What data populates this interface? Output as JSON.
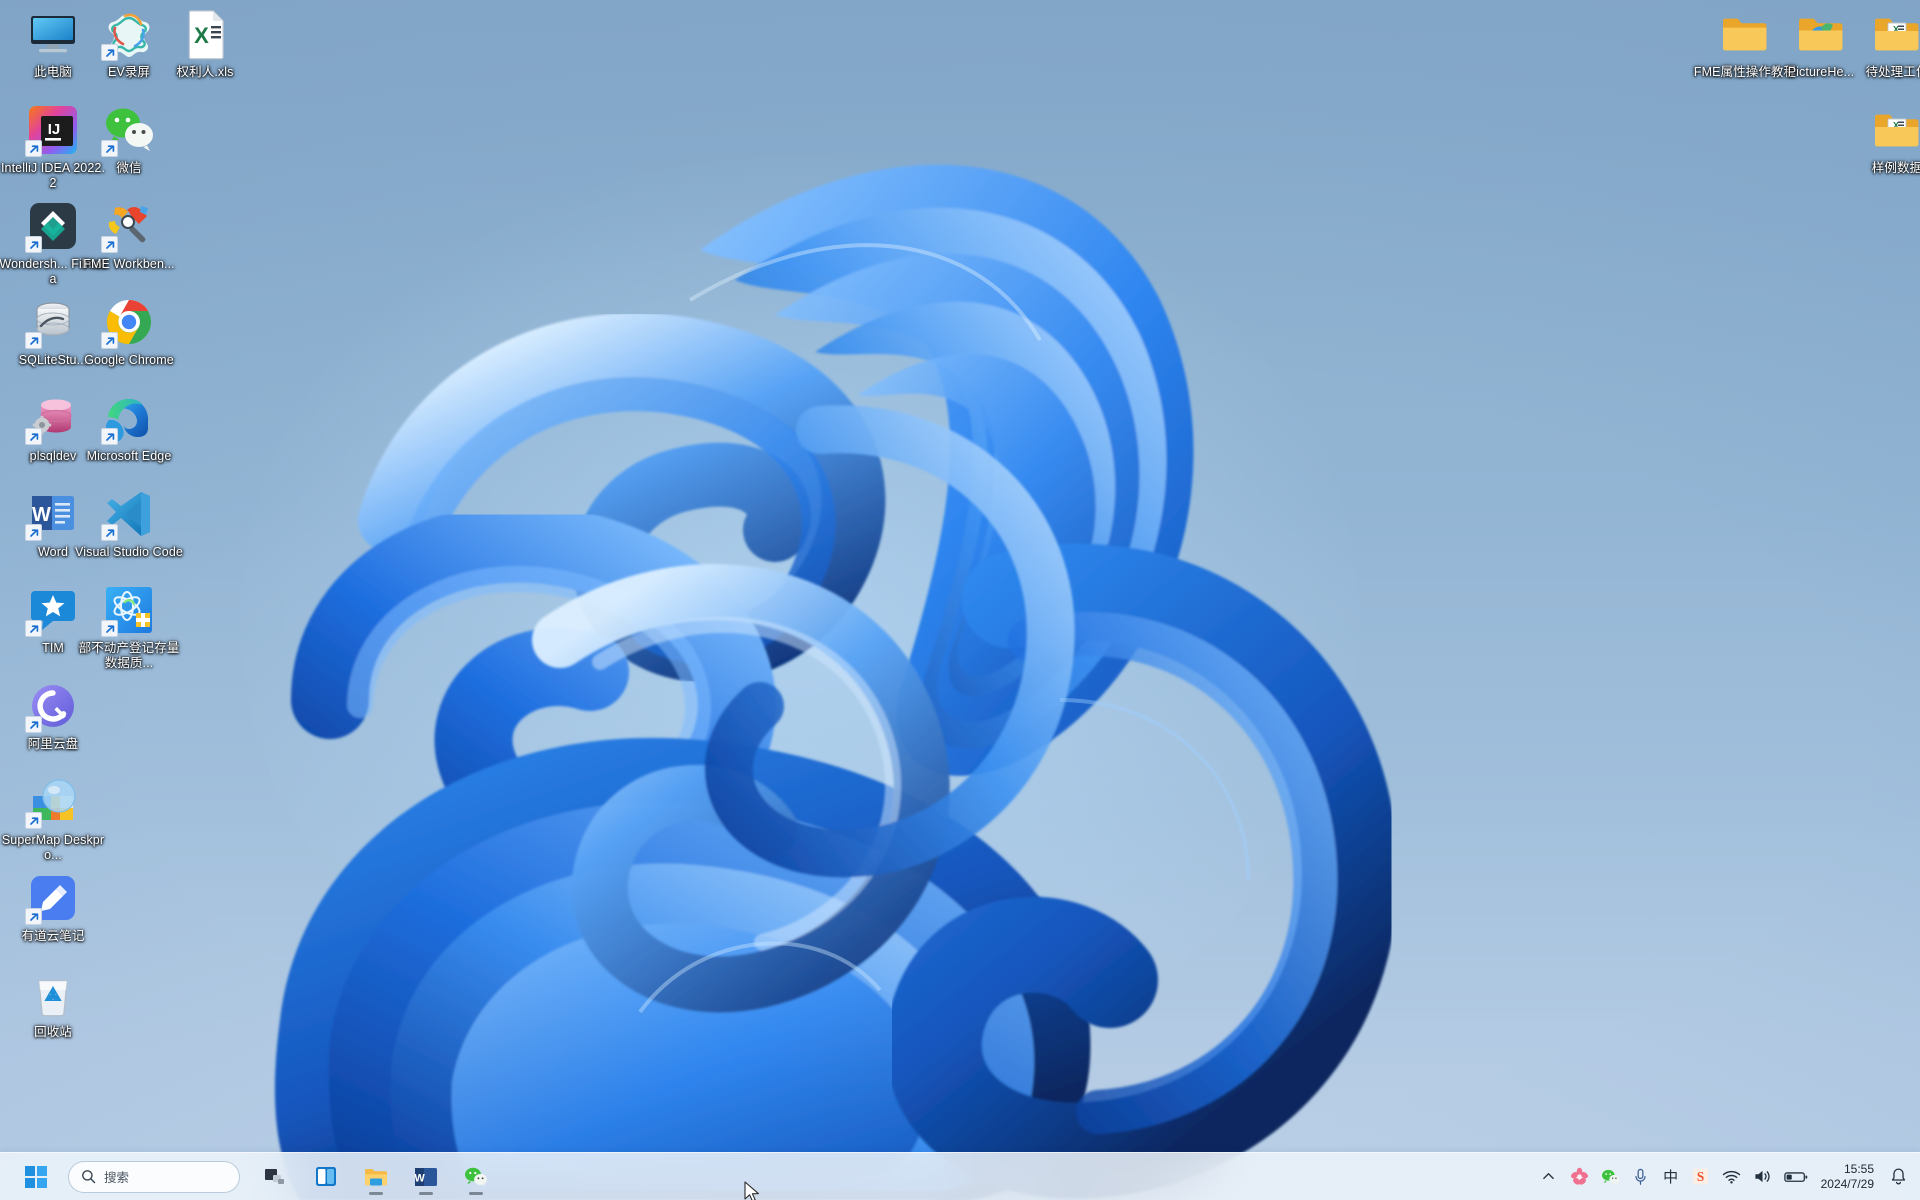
{
  "desktop": {
    "wallpaper_name": "windows-11-bloom-blue",
    "background_top_color": "#8aadcc",
    "background_bottom_color": "#bcd1e8",
    "bloom_color": "#1f6fe0",
    "icons_left": [
      {
        "label": "此电脑",
        "icon": "this-pc-icon",
        "shortcut": false,
        "col": 0,
        "row": 0
      },
      {
        "label": "EV录屏",
        "icon": "ev-recorder-icon",
        "shortcut": true,
        "col": 1,
        "row": 0
      },
      {
        "label": "权利人.xls",
        "icon": "excel-file-icon",
        "shortcut": false,
        "col": 2,
        "row": 0
      },
      {
        "label": "IntelliJ IDEA 2022.2",
        "icon": "intellij-idea-icon",
        "shortcut": true,
        "col": 0,
        "row": 1
      },
      {
        "label": "微信",
        "icon": "wechat-icon",
        "shortcut": true,
        "col": 1,
        "row": 1
      },
      {
        "label": "Wondersh... Filmora",
        "icon": "filmora-icon",
        "shortcut": true,
        "col": 0,
        "row": 2
      },
      {
        "label": "FME Workben...",
        "icon": "fme-workbench-icon",
        "shortcut": true,
        "col": 1,
        "row": 2
      },
      {
        "label": "SQLiteStu...",
        "icon": "sqlite-studio-icon",
        "shortcut": true,
        "col": 0,
        "row": 3
      },
      {
        "label": "Google Chrome",
        "icon": "google-chrome-icon",
        "shortcut": true,
        "col": 1,
        "row": 3
      },
      {
        "label": "plsqldev",
        "icon": "plsql-developer-icon",
        "shortcut": true,
        "col": 0,
        "row": 4
      },
      {
        "label": "Microsoft Edge",
        "icon": "microsoft-edge-icon",
        "shortcut": true,
        "col": 1,
        "row": 4
      },
      {
        "label": "Word",
        "icon": "microsoft-word-icon",
        "shortcut": true,
        "col": 0,
        "row": 5
      },
      {
        "label": "Visual Studio Code",
        "icon": "visual-studio-code-icon",
        "shortcut": true,
        "col": 1,
        "row": 5
      },
      {
        "label": "TIM",
        "icon": "tim-icon",
        "shortcut": true,
        "col": 0,
        "row": 6
      },
      {
        "label": "部不动产登记存量数据质...",
        "icon": "realestate-registry-app-icon",
        "shortcut": true,
        "col": 1,
        "row": 6
      },
      {
        "label": "阿里云盘",
        "icon": "aliyun-drive-icon",
        "shortcut": true,
        "col": 0,
        "row": 7
      },
      {
        "label": "SuperMap Deskpro...",
        "icon": "supermap-deskpro-icon",
        "shortcut": true,
        "col": 0,
        "row": 8
      },
      {
        "label": "有道云笔记",
        "icon": "youdao-note-icon",
        "shortcut": true,
        "col": 0,
        "row": 9
      },
      {
        "label": "回收站",
        "icon": "recycle-bin-icon",
        "shortcut": false,
        "col": 0,
        "row": 10
      }
    ],
    "icons_right": [
      {
        "label": "FME属性操作教程",
        "icon": "folder-icon",
        "col": 0,
        "row": 0
      },
      {
        "label": "PictureHe...",
        "icon": "folder-picture-icon",
        "col": 1,
        "row": 0
      },
      {
        "label": "待处理工作",
        "icon": "folder-documents-icon",
        "col": 2,
        "row": 0
      },
      {
        "label": "样例数据",
        "icon": "folder-documents-icon",
        "col": 2,
        "row": 1
      }
    ]
  },
  "taskbar": {
    "start_label": "开始",
    "start_icon": "windows-logo-icon",
    "search": {
      "placeholder": "搜索",
      "value": "",
      "icon": "search-icon"
    },
    "pinned": [
      {
        "label": "任务视图",
        "icon": "task-view-icon",
        "running": false
      },
      {
        "label": "小组件",
        "icon": "widgets-icon",
        "running": false
      },
      {
        "label": "文件资源管理器",
        "icon": "file-explorer-icon",
        "running": true
      },
      {
        "label": "Word",
        "icon": "microsoft-word-icon",
        "running": true
      },
      {
        "label": "微信",
        "icon": "wechat-icon",
        "running": true
      }
    ],
    "tray": {
      "overflow": {
        "label": "显示隐藏的图标",
        "icon": "chevron-up-icon"
      },
      "items": [
        {
          "label": "Wondershare",
          "icon": "flower-tray-icon"
        },
        {
          "label": "微信",
          "icon": "wechat-tray-icon"
        },
        {
          "label": "麦克风",
          "icon": "microphone-icon"
        },
        {
          "label": "中文输入法",
          "icon": "ime-chinese-icon",
          "text": "中"
        },
        {
          "label": "搜狗输入法",
          "icon": "sogou-icon",
          "text": "S"
        },
        {
          "label": "网络",
          "icon": "wifi-icon"
        },
        {
          "label": "音量",
          "icon": "volume-icon"
        },
        {
          "label": "电池",
          "icon": "battery-icon"
        }
      ],
      "clock": {
        "time": "15:55",
        "date": "2024/7/29"
      },
      "notifications": {
        "label": "通知",
        "icon": "bell-icon",
        "count": ""
      }
    }
  }
}
